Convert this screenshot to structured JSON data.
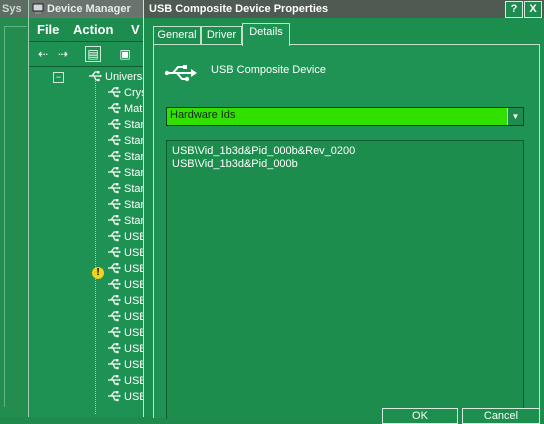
{
  "background_window": {
    "title": "Sys"
  },
  "device_manager": {
    "title": "Device Manager",
    "menu": [
      "File",
      "Action",
      "V"
    ],
    "toolbar": [
      "back-icon",
      "forward-icon",
      "properties-icon",
      "print-icon"
    ],
    "tree": {
      "root": "Universal S",
      "items": [
        {
          "label": "Crystal",
          "warning": false
        },
        {
          "label": "Matrix (",
          "warning": false
        },
        {
          "label": "Standa",
          "warning": false
        },
        {
          "label": "Standa",
          "warning": false
        },
        {
          "label": "Standa",
          "warning": false
        },
        {
          "label": "Standa",
          "warning": false
        },
        {
          "label": "Standa",
          "warning": false
        },
        {
          "label": "Standa",
          "warning": false
        },
        {
          "label": "Standa",
          "warning": false
        },
        {
          "label": "USB Co",
          "warning": false
        },
        {
          "label": "USB Co",
          "warning": false
        },
        {
          "label": "USB Co",
          "warning": true
        },
        {
          "label": "USB Ma",
          "warning": false
        },
        {
          "label": "USB Ro",
          "warning": false
        },
        {
          "label": "USB Ro",
          "warning": false
        },
        {
          "label": "USB Ro",
          "warning": false
        },
        {
          "label": "USB Ro",
          "warning": false
        },
        {
          "label": "USB Ro",
          "warning": false
        },
        {
          "label": "USB Ro",
          "warning": false
        },
        {
          "label": "USB Ro",
          "warning": false
        }
      ]
    }
  },
  "dialog": {
    "title": "USB Composite Device Properties",
    "help_button": "?",
    "close_button": "X",
    "tabs": [
      "General",
      "Driver",
      "Details"
    ],
    "active_tab": "Details",
    "device_name": "USB Composite Device",
    "property_select": {
      "value": "Hardware Ids"
    },
    "values": [
      "USB\\Vid_1b3d&Pid_000b&Rev_0200",
      "USB\\Vid_1b3d&Pid_000b"
    ],
    "footer_buttons": [
      "OK",
      "Cancel"
    ]
  },
  "colors": {
    "window_bg": "#1c8e4e",
    "title_bar": "#4e5a52",
    "select_bg": "#32e000",
    "text": "#ffffff"
  }
}
